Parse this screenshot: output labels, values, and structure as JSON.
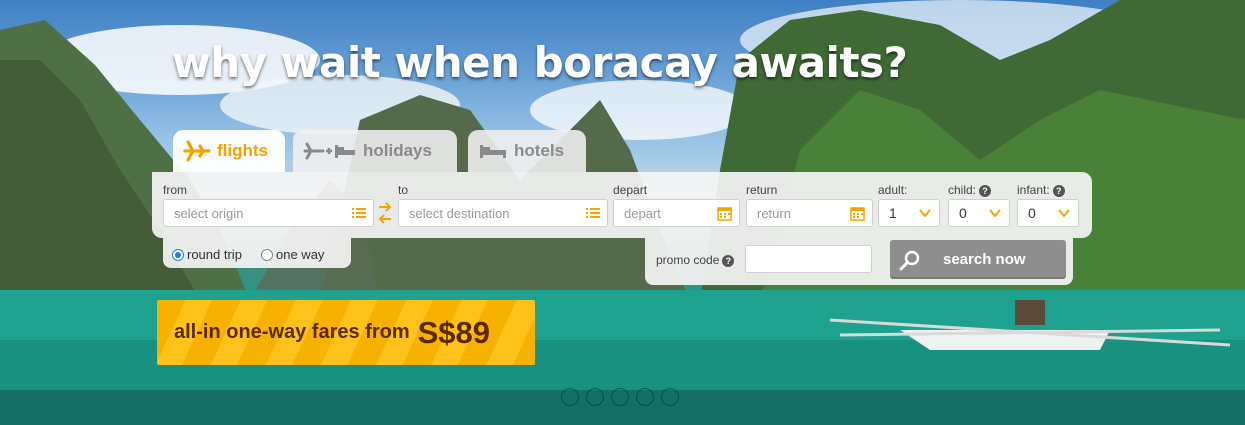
{
  "headline": "why wait when boracay awaits?",
  "tabs": [
    {
      "label": "flights",
      "icon": "plane-icon",
      "active": true
    },
    {
      "label": "holidays",
      "icon": "plane-plus-bed-icon",
      "active": false
    },
    {
      "label": "hotels",
      "icon": "bed-icon",
      "active": false
    }
  ],
  "search": {
    "from_label": "from",
    "from_placeholder": "select origin",
    "to_label": "to",
    "to_placeholder": "select destination",
    "depart_label": "depart",
    "depart_placeholder": "depart",
    "return_label": "return",
    "return_placeholder": "return",
    "adult_label": "adult:",
    "adult_value": "1",
    "child_label": "child:",
    "child_value": "0",
    "infant_label": "infant:",
    "infant_value": "0",
    "trip_round": "round trip",
    "trip_oneway": "one way",
    "promo_label": "promo code",
    "search_button": "search now"
  },
  "banner": {
    "text": "all-in one-way fares from",
    "price": "S$89"
  },
  "carousel": {
    "count": 5,
    "active_index": 3
  },
  "colors": {
    "accent": "#f5a300",
    "banner": "#f7b100",
    "button": "#8e8e8e",
    "radio": "#1f7de0"
  }
}
